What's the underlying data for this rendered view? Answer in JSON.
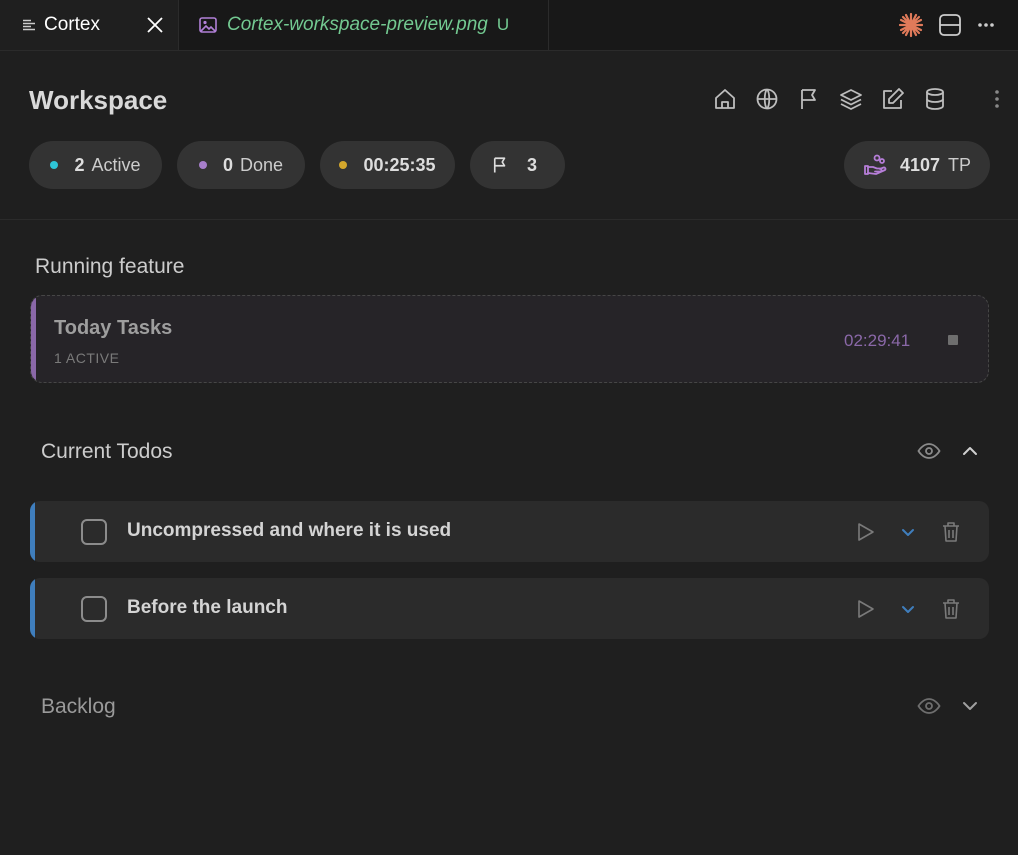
{
  "tabs": {
    "active": {
      "title": "Cortex"
    },
    "inactive": {
      "title": "Cortex-workspace-preview.png",
      "status": "U"
    }
  },
  "header": {
    "title": "Workspace",
    "icons": [
      "home-icon",
      "globe-icon",
      "flag-icon",
      "layers-icon",
      "edit-icon",
      "database-icon",
      "more-vertical-icon"
    ]
  },
  "stats": {
    "active": {
      "count": "2",
      "label": "Active",
      "color": "#2ec4d6"
    },
    "done": {
      "count": "0",
      "label": "Done",
      "color": "#a77fcb"
    },
    "timer": {
      "value": "00:25:35",
      "color": "#d4a72c"
    },
    "flags": {
      "count": "3"
    },
    "tp": {
      "value": "4107",
      "label": "TP",
      "color": "#b67ed8"
    }
  },
  "running": {
    "section_title": "Running feature",
    "feature": {
      "name": "Today Tasks",
      "subtitle": "1 ACTIVE",
      "time": "02:29:41",
      "accent": "#8a68a8"
    }
  },
  "todos": {
    "section_title": "Current Todos",
    "items": [
      {
        "text": "Uncompressed and where it is used"
      },
      {
        "text": "Before the launch"
      }
    ],
    "accent": "#3f7ebd"
  },
  "backlog": {
    "section_title": "Backlog"
  }
}
